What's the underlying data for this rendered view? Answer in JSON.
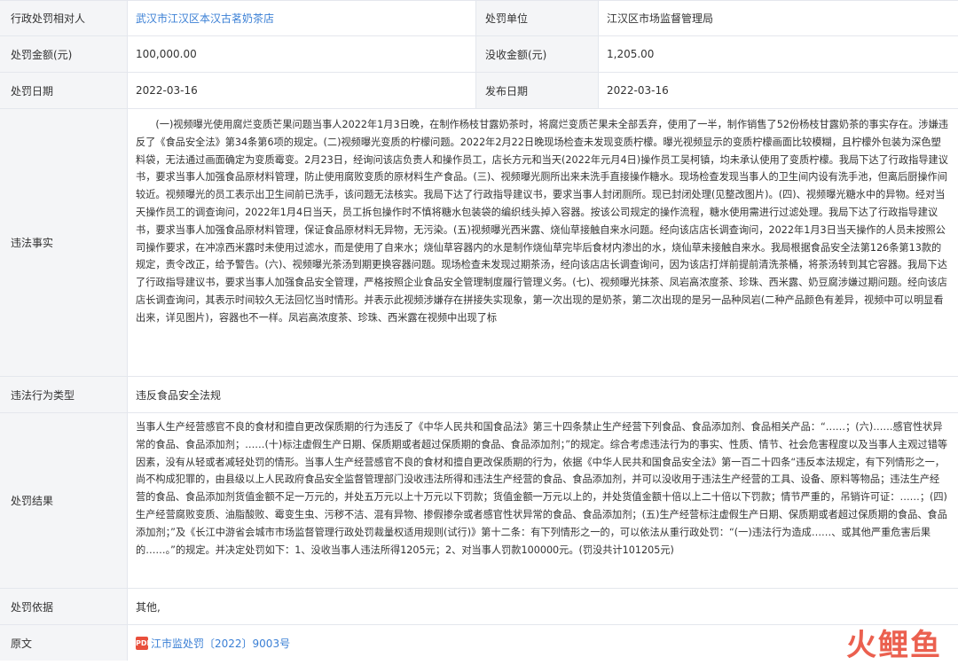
{
  "rows": {
    "target": {
      "label": "行政处罚相对人",
      "value": "武汉市江汉区本汉古茗奶茶店"
    },
    "unit": {
      "label": "处罚单位",
      "value": "江汉区市场监督管理局"
    },
    "amount": {
      "label": "处罚金额(元)",
      "value": "100,000.00"
    },
    "confiscated": {
      "label": "没收金额(元)",
      "value": "1,205.00"
    },
    "date": {
      "label": "处罚日期",
      "value": "2022-03-16"
    },
    "publish": {
      "label": "发布日期",
      "value": "2022-03-16"
    },
    "facts": {
      "label": "违法事实",
      "text": "(一)视频曝光使用腐烂变质芒果问题当事人2022年1月3日晚，在制作杨枝甘露奶茶时，将腐烂变质芒果未全部丢弃，使用了一半，制作销售了52份杨枝甘露奶茶的事实存在。涉嫌违反了《食品安全法》第34条第6项的规定。(二)视频曝光变质的柠檬问题。2022年2月22日晚现场检查未发现变质柠檬。曝光视频显示的变质柠檬画面比较模糊，且柠檬外包装为深色塑料袋，无法通过画面确定为变质霉变。2月23日，经询问该店负责人和操作员工，店长方元和当天(2022年元月4日)操作员工吴柯镇，均未承认使用了变质柠檬。我局下达了行政指导建议书，要求当事人加强食品原材料管理，防止使用腐败变质的原材料生产食品。(三)、视频曝光厕所出来未洗手直接操作糖水。现场检查发现当事人的卫生间内设有洗手池，但离后厨操作间较近。视频曝光的员工表示出卫生间前已洗手，该问题无法核实。我局下达了行政指导建议书，要求当事人封闭厕所。现已封闭处理(见整改图片)。(四)、视频曝光糖水中的异物。经对当天操作员工的调查询问，2022年1月4日当天，员工拆包操作时不慎将糖水包装袋的编织线头掉入容器。按该公司规定的操作流程，糖水使用需进行过滤处理。我局下达了行政指导建议书，要求当事人加强食品原材料管理，保证食品原材料无异物，无污染。(五)视频曝光西米露、烧仙草接触自来水问题。经向该店店长调查询问，2022年1月3日当天操作的人员未按照公司操作要求，在冲凉西米露时未使用过滤水，而是使用了自来水；烧仙草容器内的水是制作烧仙草完毕后食材内渗出的水，烧仙草未接触自来水。我局根据食品安全法第126条第13款的规定，责令改正，给予警告。(六)、视频曝光茶汤到期更换容器问题。现场检查未发现过期茶汤，经向该店店长调查询问，因为该店打烊前提前清洗茶桶，将茶汤转到其它容器。我局下达了行政指导建议书，要求当事人加强食品安全管理，严格按照企业食品安全管理制度履行管理义务。(七)、视频曝光抹茶、凤岩高浓度茶、珍珠、西米露、奶豆腐涉嫌过期问题。经向该店店长调查询问，其表示时间较久无法回忆当时情形。并表示此视频涉嫌存在拼接失实现象，第一次出现的是奶茶，第二次出现的是另一品种凤岩(二种产品颜色有差异，视频中可以明显看出来，详见图片)，容器也不一样。凤岩高浓度茶、珍珠、西米露在视频中出现了标"
    },
    "type": {
      "label": "违法行为类型",
      "value": "违反食品安全法规"
    },
    "result": {
      "label": "处罚结果",
      "text": "当事人生产经营感官不良的食材和擅自更改保质期的行为违反了《中华人民共和国食品法》第三十四条禁止生产经营下列食品、食品添加剂、食品相关产品：“……；(六)……感官性状异常的食品、食品添加剂；……(十)标注虚假生产日期、保质期或者超过保质期的食品、食品添加剂；”的规定。综合考虑违法行为的事实、性质、情节、社会危害程度以及当事人主观过错等因素，没有从轻或者减轻处罚的情形。当事人生产经营感官不良的食材和擅自更改保质期的行为，依据《中华人民共和国食品安全法》第一百二十四条“违反本法规定，有下列情形之一，尚不构成犯罪的，由县级以上人民政府食品安全监督管理部门没收违法所得和违法生产经营的食品、食品添加剂，并可以没收用于违法生产经营的工具、设备、原料等物品；违法生产经营的食品、食品添加剂货值金额不足一万元的，并处五万元以上十万元以下罚款；货值金额一万元以上的，并处货值金额十倍以上二十倍以下罚款；情节严重的，吊销许可证：……；(四)生产经营腐败变质、油脂酸败、霉变生虫、污秽不洁、混有异物、掺假掺杂或者感官性状异常的食品、食品添加剂；(五)生产经营标注虚假生产日期、保质期或者超过保质期的食品、食品添加剂；”及《长江中游省会城市市场监督管理行政处罚裁量权适用规则(试行)》第十二条：有下列情形之一的，可以依法从重行政处罚：“(一)违法行为造成……、或其他严重危害后果的……。”的规定。并决定处罚如下：1、没收当事人违法所得1205元；2、对当事人罚款100000元。(罚没共计101205元)"
    },
    "basis": {
      "label": "处罚依据",
      "value": "其他,"
    },
    "source": {
      "label": "原文",
      "value": "江市监处罚〔2022〕9003号",
      "icon": "pdf-icon",
      "icon_text": "PDF"
    }
  },
  "watermark": {
    "text": "火鲤鱼",
    "color": "#e94f3c"
  }
}
